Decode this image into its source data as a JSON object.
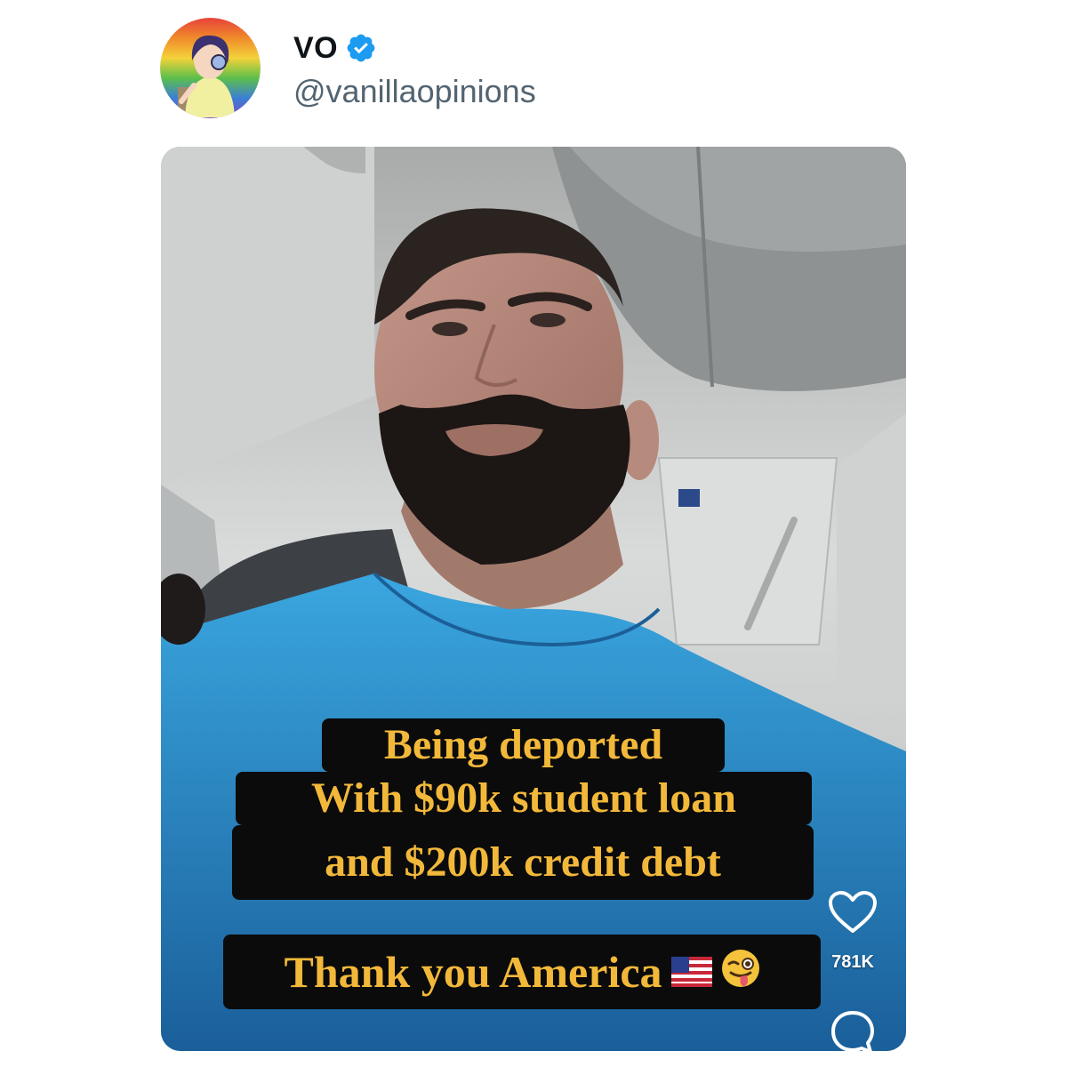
{
  "author": {
    "display_name": "VO",
    "handle": "@vanillaopinions",
    "verified": true,
    "verified_color": "#1d9bf0",
    "avatar_icon": "anime-girl-rainbow-avatar"
  },
  "media": {
    "captions": [
      "Being deported",
      "With $90k student loan",
      "and $200k credit debt"
    ],
    "closing_caption": "Thank you America",
    "closing_emojis": [
      "us-flag-emoji",
      "winking-tongue-emoji"
    ],
    "caption_text_color": "#f2b83a",
    "caption_bg_color": "#0b0b0b",
    "likes_count": "781K",
    "like_icon": "heart-icon",
    "comment_icon": "comment-bubble-icon"
  }
}
